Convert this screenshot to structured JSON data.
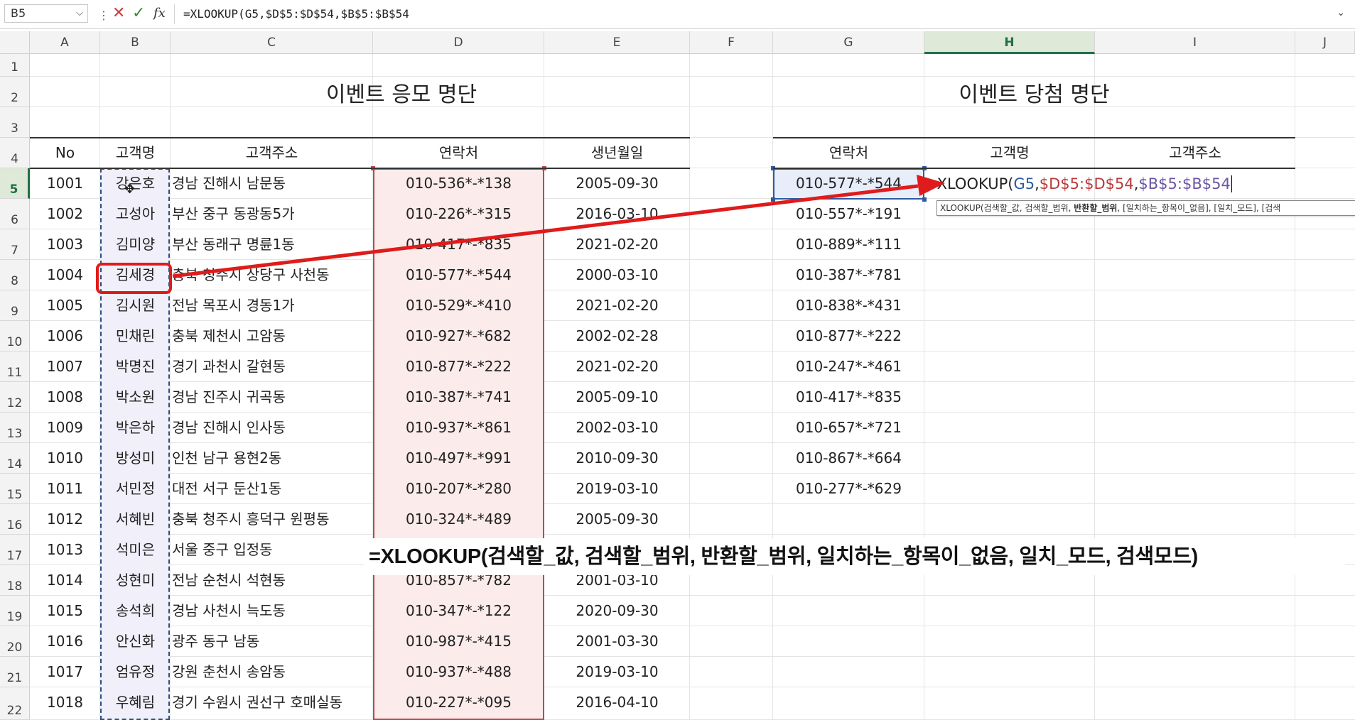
{
  "formula_bar": {
    "name_box": "B5",
    "formula": "=XLOOKUP(G5,$D$5:$D$54,$B$5:$B$54"
  },
  "columns": [
    "A",
    "B",
    "C",
    "D",
    "E",
    "F",
    "G",
    "H",
    "I",
    "J"
  ],
  "rows": [
    "1",
    "2",
    "3",
    "4",
    "5",
    "6",
    "7",
    "8",
    "9",
    "10",
    "11",
    "12",
    "13",
    "14",
    "15",
    "16",
    "17",
    "18",
    "19",
    "20",
    "21",
    "22"
  ],
  "left_table": {
    "title": "이벤트 응모 명단",
    "headers": [
      "No",
      "고객명",
      "고객주소",
      "연락처",
      "생년월일"
    ],
    "rows": [
      [
        "1001",
        "강은호",
        "경남 진해시 남문동",
        "010-536*-*138",
        "2005-09-30"
      ],
      [
        "1002",
        "고성아",
        "부산 중구 동광동5가",
        "010-226*-*315",
        "2016-03-10"
      ],
      [
        "1003",
        "김미양",
        "부산 동래구 명륜1동",
        "010-417*-*835",
        "2021-02-20"
      ],
      [
        "1004",
        "김세경",
        "충북 청주시 상당구 사천동",
        "010-577*-*544",
        "2000-03-10"
      ],
      [
        "1005",
        "김시원",
        "전남 목포시 경동1가",
        "010-529*-*410",
        "2021-02-20"
      ],
      [
        "1006",
        "민채린",
        "충북 제천시 고암동",
        "010-927*-*682",
        "2002-02-28"
      ],
      [
        "1007",
        "박명진",
        "경기 과천시 갈현동",
        "010-877*-*222",
        "2021-02-20"
      ],
      [
        "1008",
        "박소원",
        "경남 진주시 귀곡동",
        "010-387*-*741",
        "2005-09-10"
      ],
      [
        "1009",
        "박은하",
        "경남 진해시 인사동",
        "010-937*-*861",
        "2002-03-10"
      ],
      [
        "1010",
        "방성미",
        "인천 남구 용현2동",
        "010-497*-*991",
        "2010-09-30"
      ],
      [
        "1011",
        "서민정",
        "대전 서구 둔산1동",
        "010-207*-*280",
        "2019-03-10"
      ],
      [
        "1012",
        "서혜빈",
        "충북 청주시 흥덕구 원평동",
        "010-324*-*489",
        "2005-09-30"
      ],
      [
        "1013",
        "석미은",
        "서울 중구 입정동",
        "",
        ""
      ],
      [
        "1014",
        "성현미",
        "전남 순천시 석현동",
        "010-857*-*782",
        "2001-03-10"
      ],
      [
        "1015",
        "송석희",
        "경남 사천시 늑도동",
        "010-347*-*122",
        "2020-09-30"
      ],
      [
        "1016",
        "안신화",
        "광주 동구 남동",
        "010-987*-*415",
        "2001-03-30"
      ],
      [
        "1017",
        "엄유정",
        "강원 춘천시 송암동",
        "010-937*-*488",
        "2019-03-10"
      ],
      [
        "1018",
        "우혜림",
        "경기 수원시 권선구 호매실동",
        "010-227*-*095",
        "2016-04-10"
      ]
    ]
  },
  "right_table": {
    "title": "이벤트 당첨 명단",
    "headers": [
      "연락처",
      "고객명",
      "고객주소"
    ],
    "contacts": [
      "010-577*-*544",
      "010-557*-*191",
      "010-889*-*111",
      "010-387*-*781",
      "010-838*-*431",
      "010-877*-*222",
      "010-247*-*461",
      "010-417*-*835",
      "010-657*-*721",
      "010-867*-*664",
      "010-277*-*629"
    ]
  },
  "editing": {
    "prefix": "=XLOOKUP(",
    "arg1": "G5",
    "comma1": ",",
    "arg2": "$D$5:$D$54",
    "comma2": ",",
    "arg3": "$B$5:$B$54"
  },
  "tooltip": {
    "before": "XLOOKUP(검색할_값, 검색할_범위, ",
    "bold": "반환할_범위",
    "after": ", [일치하는_항목이_없음], [일치_모드], [검색"
  },
  "callout": "=XLOOKUP(검색할_값, 검색할_범위, 반환할_범위, 일치하는_항목이_없음, 일치_모드, 검색모드)",
  "colors": {
    "accent": "#1e7145",
    "range_b": "#2d4f7c",
    "range_d": "#b84a4a",
    "range_g": "#2d5aa0",
    "annotation": "#e01b1b"
  }
}
